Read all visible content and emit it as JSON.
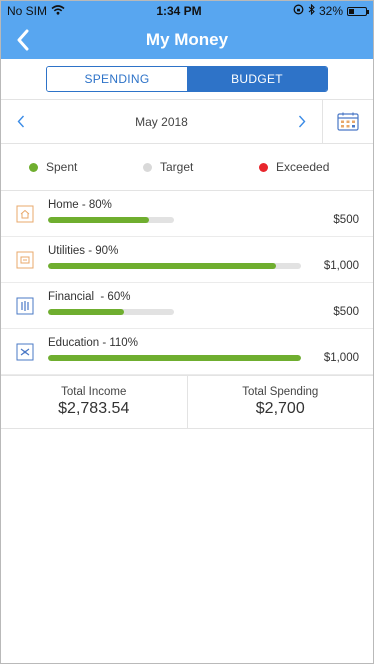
{
  "status": {
    "carrier": "No SIM",
    "time": "1:34 PM",
    "battery": "32%"
  },
  "nav": {
    "title": "My Money",
    "back_icon": "chevron-left-icon"
  },
  "tabs": [
    {
      "label": "SPENDING",
      "active": false
    },
    {
      "label": "BUDGET",
      "active": true
    }
  ],
  "month": {
    "label": "May 2018",
    "prev_icon": "chevron-left-icon",
    "next_icon": "chevron-right-icon",
    "calendar_icon": "calendar-icon"
  },
  "legend": [
    {
      "label": "Spent",
      "color": "#6fae2f"
    },
    {
      "label": "Target",
      "color": "#d9d9d9"
    },
    {
      "label": "Exceeded",
      "color": "#e8262c"
    }
  ],
  "categories": [
    {
      "label": "Home - 80%",
      "amount": "$500",
      "spent_fraction": 0.8,
      "icon": "home-icon",
      "icon_color": "#e8a86b"
    },
    {
      "label": "Utilities - 90%",
      "amount": "$1,000",
      "spent_fraction": 0.9,
      "icon": "utilities-icon",
      "icon_color": "#e8a86b"
    },
    {
      "label": "Financial  - 60%",
      "amount": "$500",
      "spent_fraction": 0.6,
      "icon": "financial-icon",
      "icon_color": "#4a78c6"
    },
    {
      "label": "Education - 110%",
      "amount": "$1,000",
      "spent_fraction": 1.1,
      "icon": "education-icon",
      "icon_color": "#4a78c6"
    }
  ],
  "totals": {
    "income": {
      "label": "Total Income",
      "value": "$2,783.54"
    },
    "spending": {
      "label": "Total Spending",
      "value": "$2,700"
    }
  },
  "colors": {
    "header": "#58a6f0",
    "accent": "#2e73c8",
    "spent": "#6fae2f",
    "track": "#e2e2e2"
  }
}
